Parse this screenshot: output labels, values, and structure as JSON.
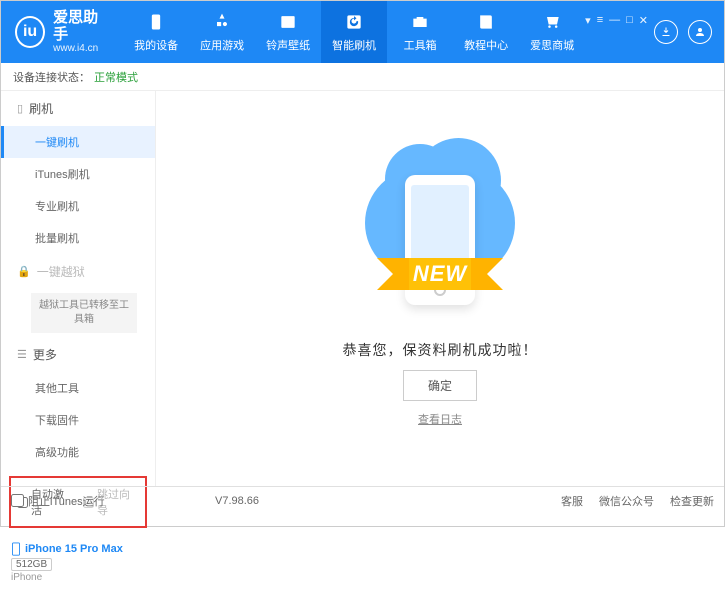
{
  "app": {
    "title": "爱思助手",
    "url": "www.i4.cn"
  },
  "nav": [
    {
      "label": "我的设备"
    },
    {
      "label": "应用游戏"
    },
    {
      "label": "铃声壁纸"
    },
    {
      "label": "智能刷机",
      "active": true
    },
    {
      "label": "工具箱"
    },
    {
      "label": "教程中心"
    },
    {
      "label": "爱思商城"
    }
  ],
  "status": {
    "label": "设备连接状态：",
    "value": "正常模式"
  },
  "sidebar": {
    "groups": [
      {
        "label": "刷机",
        "items": [
          {
            "label": "一键刷机",
            "active": true
          },
          {
            "label": "iTunes刷机"
          },
          {
            "label": "专业刷机"
          },
          {
            "label": "批量刷机"
          }
        ]
      },
      {
        "label": "一键越狱",
        "locked": true,
        "note": "越狱工具已转移至工具箱"
      },
      {
        "label": "更多",
        "items": [
          {
            "label": "其他工具"
          },
          {
            "label": "下载固件"
          },
          {
            "label": "高级功能"
          }
        ]
      }
    ],
    "options": {
      "auto_activate": "自动激活",
      "skip_guide": "跳过向导"
    }
  },
  "device": {
    "name": "iPhone 15 Pro Max",
    "storage": "512GB",
    "type": "iPhone"
  },
  "main": {
    "ribbon": "NEW",
    "success": "恭喜您，保资料刷机成功啦！",
    "ok": "确定",
    "log": "查看日志"
  },
  "footer": {
    "block_itunes": "阻止iTunes运行",
    "version": "V7.98.66",
    "links": [
      "客服",
      "微信公众号",
      "检查更新"
    ]
  }
}
